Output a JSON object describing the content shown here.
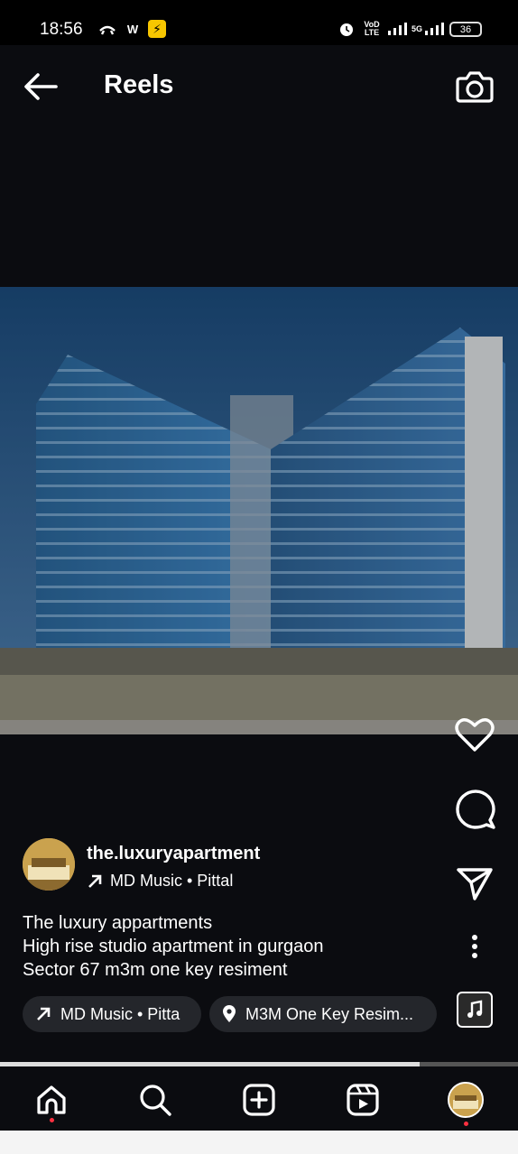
{
  "status_bar": {
    "time": "18:56",
    "icons": [
      "call-forward-icon",
      "wifi-calling-icon",
      "flipkart-icon",
      "alarm-icon",
      "volte-icon",
      "signal-icon",
      "5g-signal-icon"
    ],
    "volte": "VoD LTE",
    "network": "5G",
    "battery": "36"
  },
  "header": {
    "title": "Reels",
    "back_icon": "arrow-left-icon",
    "camera_icon": "camera-icon"
  },
  "actions": {
    "like_icon": "heart-icon",
    "comment_icon": "comment-icon",
    "share_icon": "send-icon",
    "more_icon": "more-vertical-icon",
    "audio_icon": "music-note-icon"
  },
  "post": {
    "username": "the.luxuryapartment",
    "music": "MD Music • Pittal",
    "caption_lines": [
      "The luxury appartments",
      "High rise studio apartment in gurgaon",
      "Sector 67 m3m one key resiment"
    ],
    "chips": {
      "music": "MD Music • Pitta",
      "location": "M3M One Key Resim..."
    }
  },
  "progress": 0.81,
  "nav": {
    "items": [
      "home-icon",
      "search-icon",
      "create-icon",
      "reels-icon",
      "profile-avatar"
    ]
  },
  "colors": {
    "background": "#0b0c10",
    "notification_dot": "#ff3040",
    "chip_bg": "#24262b"
  }
}
